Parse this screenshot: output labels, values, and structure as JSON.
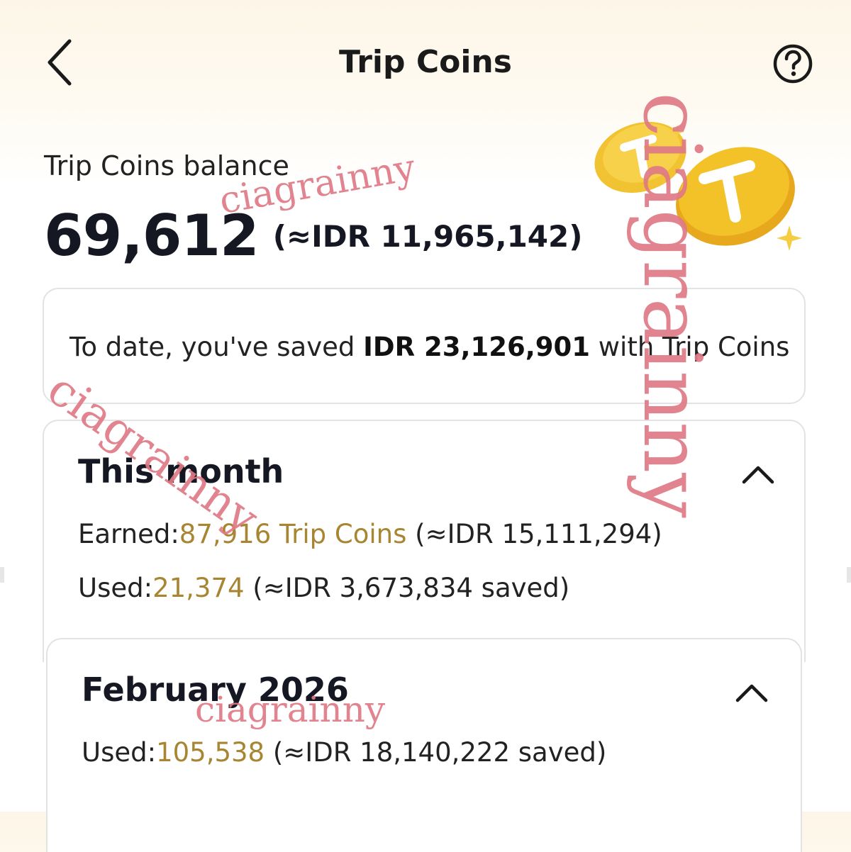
{
  "header": {
    "title": "Trip Coins",
    "back_icon": "chevron-left-icon",
    "help_icon": "question-circle-icon"
  },
  "balance": {
    "label": "Trip Coins balance",
    "value": "69,612",
    "idr": "(≈IDR 11,965,142)"
  },
  "savings": {
    "prefix": "To date, you've saved ",
    "amount": "IDR 23,126,901",
    "suffix": " with Trip Coins"
  },
  "this_month": {
    "title": "This month",
    "earned_label": "Earned:",
    "earned_value": "87,916 Trip Coins",
    "earned_idr": " (≈IDR 15,111,294)",
    "used_label": "Used:",
    "used_value": "21,374",
    "used_idr": " (≈IDR 3,673,834 saved)"
  },
  "february": {
    "title": "February 2026",
    "used_label": "Used:",
    "used_value": "105,538",
    "used_idr": " (≈IDR 18,140,222 saved)"
  },
  "watermarks": [
    "ciagrainny",
    "ciagrainny",
    "ciagrainny",
    "ciagrainny"
  ],
  "colors": {
    "accent_gold": "#a88532",
    "watermark_pink": "#e07a86",
    "coin_gold": "#f2c230"
  }
}
